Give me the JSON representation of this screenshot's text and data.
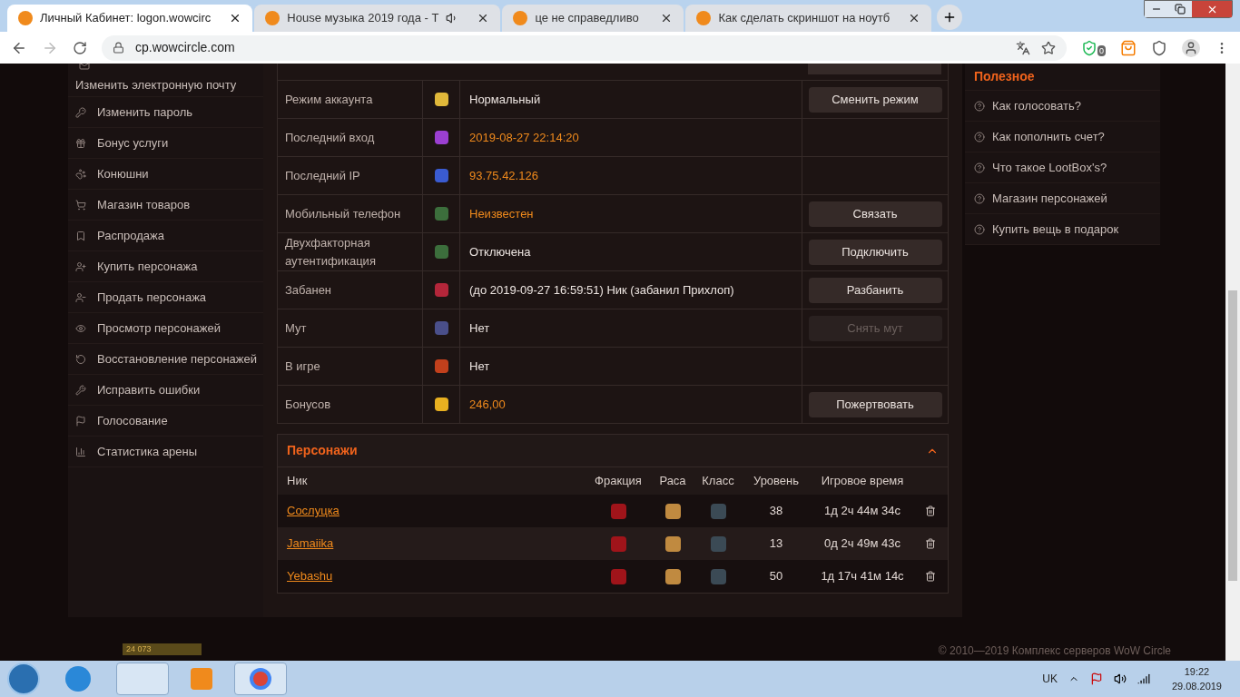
{
  "browser": {
    "tabs": [
      {
        "title": "Личный Кабинет: logon.wowcirc",
        "selected": true,
        "audio": false
      },
      {
        "title": "House музыка 2019 года - Т",
        "selected": false,
        "audio": true
      },
      {
        "title": "це не справедливо",
        "selected": false,
        "audio": false
      },
      {
        "title": "Как сделать скриншот на ноутб",
        "selected": false,
        "audio": false
      }
    ],
    "url": "cp.wowcircle.com",
    "extension_badge": "0"
  },
  "sidebar": {
    "items": [
      {
        "label": "Изменить электронную почту"
      },
      {
        "label": "Изменить пароль"
      },
      {
        "label": "Бонус услуги"
      },
      {
        "label": "Конюшни"
      },
      {
        "label": "Магазин товаров"
      },
      {
        "label": "Распродажа"
      },
      {
        "label": "Купить персонажа"
      },
      {
        "label": "Продать персонажа"
      },
      {
        "label": "Просмотр персонажей"
      },
      {
        "label": "Восстановление персонажей"
      },
      {
        "label": "Исправить ошибки"
      },
      {
        "label": "Голосование"
      },
      {
        "label": "Статистика арены"
      }
    ]
  },
  "account": {
    "rows": [
      {
        "label": "Режим аккаунта",
        "value": "Нормальный",
        "highlight": false,
        "button": {
          "label": "Сменить режим",
          "disabled": false
        }
      },
      {
        "label": "Последний вход",
        "value": "2019-08-27 22:14:20",
        "highlight": true
      },
      {
        "label": "Последний IP",
        "value": "93.75.42.126",
        "highlight": true
      },
      {
        "label": "Мобильный телефон",
        "value": "Неизвестен",
        "highlight": true,
        "button": {
          "label": "Связать",
          "disabled": false
        }
      },
      {
        "label": "Двухфакторная аутентификация",
        "value": "Отключена",
        "highlight": false,
        "button": {
          "label": "Подключить",
          "disabled": false
        }
      },
      {
        "label": "Забанен",
        "value": "(до 2019-09-27 16:59:51) Ник (забанил Прихлоп)",
        "highlight": false,
        "button": {
          "label": "Разбанить",
          "disabled": false
        }
      },
      {
        "label": "Мут",
        "value": "Нет",
        "highlight": false,
        "button": {
          "label": "Снять мут",
          "disabled": true
        }
      },
      {
        "label": "В игре",
        "value": "Нет",
        "highlight": false
      },
      {
        "label": "Бонусов",
        "value": "246,00",
        "highlight": true,
        "button": {
          "label": "Пожертвовать",
          "disabled": false
        }
      }
    ]
  },
  "characters": {
    "title": "Персонажи",
    "expanded": true,
    "columns": [
      "Ник",
      "Фракция",
      "Раса",
      "Класс",
      "Уровень",
      "Игровое время"
    ],
    "rows": [
      {
        "name": "Сослуцка",
        "level": "38",
        "time": "1д 2ч 44м 34с"
      },
      {
        "name": "Jamaiika",
        "level": "13",
        "time": "0д 2ч 49м 43с"
      },
      {
        "name": "Yebashu",
        "level": "50",
        "time": "1д 17ч 41м 14с"
      }
    ]
  },
  "useful": {
    "title": "Полезное",
    "links": [
      "Как голосовать?",
      "Как пополнить счет?",
      "Что такое LootBox's?",
      "Магазин персонажей",
      "Купить вещь в подарок"
    ]
  },
  "footer": {
    "counter": "24 073",
    "copyright": "© 2010—2019 Комплекс серверов WoW Circle"
  },
  "taskbar": {
    "language": "UK",
    "time": "19:22",
    "date": "29.08.2019"
  }
}
